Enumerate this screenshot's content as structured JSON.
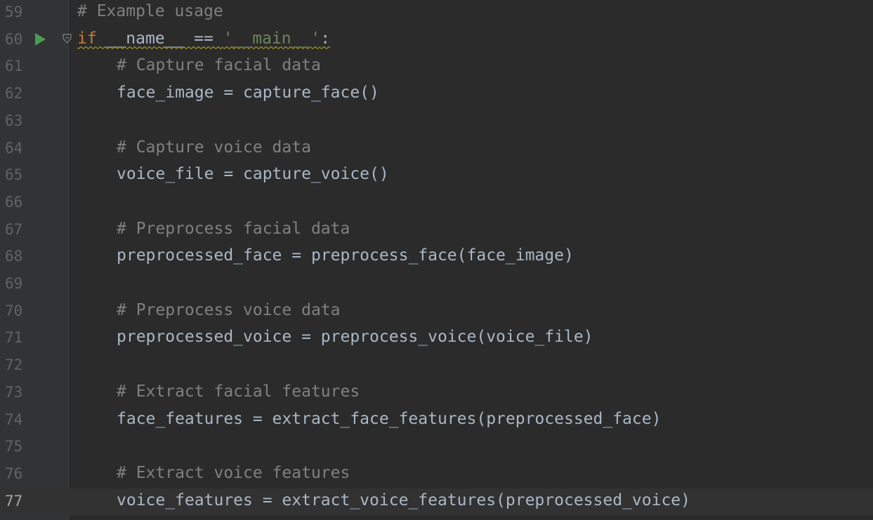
{
  "editor": {
    "current_line": "77",
    "lines": [
      {
        "num": "59",
        "segments": [
          {
            "text": "# Example usage",
            "kind": "comment"
          }
        ]
      },
      {
        "num": "60",
        "segments": [
          {
            "text": "if",
            "kind": "keyword"
          },
          {
            "text": " __name__ == ",
            "kind": "plain"
          },
          {
            "text": "'__main__'",
            "kind": "string"
          },
          {
            "text": ":",
            "kind": "plain"
          }
        ]
      },
      {
        "num": "61",
        "segments": [
          {
            "text": "# Capture facial data",
            "kind": "comment"
          }
        ]
      },
      {
        "num": "62",
        "segments": [
          {
            "text": "face_image = capture_face()",
            "kind": "plain"
          }
        ]
      },
      {
        "num": "63",
        "segments": []
      },
      {
        "num": "64",
        "segments": [
          {
            "text": "# Capture voice data",
            "kind": "comment"
          }
        ]
      },
      {
        "num": "65",
        "segments": [
          {
            "text": "voice_file = capture_voice()",
            "kind": "plain"
          }
        ]
      },
      {
        "num": "66",
        "segments": []
      },
      {
        "num": "67",
        "segments": [
          {
            "text": "# Preprocess facial data",
            "kind": "comment"
          }
        ]
      },
      {
        "num": "68",
        "segments": [
          {
            "text": "preprocessed_face = preprocess_face(face_image)",
            "kind": "plain"
          }
        ]
      },
      {
        "num": "69",
        "segments": []
      },
      {
        "num": "70",
        "segments": [
          {
            "text": "# Preprocess voice data",
            "kind": "comment"
          }
        ]
      },
      {
        "num": "71",
        "segments": [
          {
            "text": "preprocessed_voice = preprocess_voice(voice_file)",
            "kind": "plain"
          }
        ]
      },
      {
        "num": "72",
        "segments": []
      },
      {
        "num": "73",
        "segments": [
          {
            "text": "# Extract facial features",
            "kind": "comment"
          }
        ]
      },
      {
        "num": "74",
        "segments": [
          {
            "text": "face_features = extract_face_features(preprocessed_face)",
            "kind": "plain"
          }
        ]
      },
      {
        "num": "75",
        "segments": []
      },
      {
        "num": "76",
        "segments": [
          {
            "text": "# Extract voice features",
            "kind": "comment"
          }
        ]
      },
      {
        "num": "77",
        "segments": [
          {
            "text": "voice_features = extract_voice_features(preprocessed_voice)",
            "kind": "plain"
          }
        ]
      }
    ]
  },
  "gutter": {
    "run_icon": "run-triangle-icon",
    "fold_icon": "fold-arrow-icon"
  },
  "colors": {
    "background": "#2b2b2b",
    "gutter": "#313335",
    "comment": "#808080",
    "keyword": "#cc7832",
    "string": "#6a8759",
    "identifier": "#a9b7c6",
    "run_icon": "#499c54"
  }
}
